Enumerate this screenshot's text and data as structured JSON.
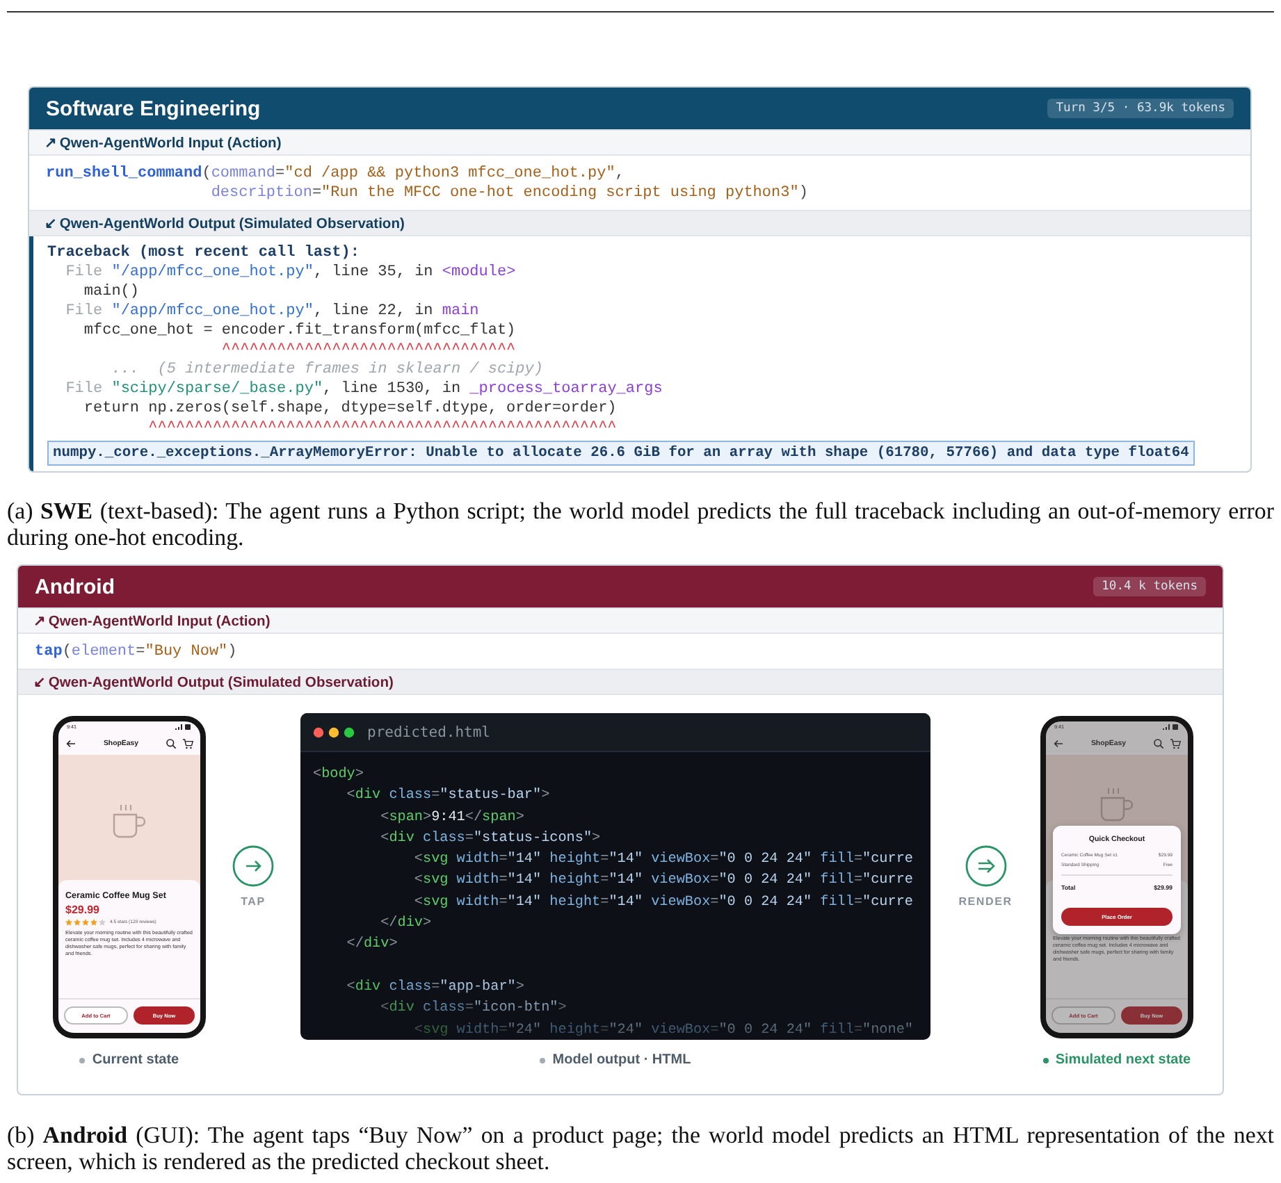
{
  "panels": [
    {
      "kind": "swe",
      "title": "Software Engineering",
      "badge": "Turn 3/5 · 63.9k tokens",
      "input_label": "↗ Qwen-AgentWorld Input (Action)",
      "input_code": [
        {
          "tokens": [
            {
              "kind": "fn",
              "text": "run_shell_command"
            },
            {
              "kind": "punct",
              "text": "("
            },
            {
              "kind": "param",
              "text": "command"
            },
            {
              "kind": "punct",
              "text": "="
            },
            {
              "kind": "str",
              "text": "\"cd /app && python3 mfcc_one_hot.py\""
            },
            {
              "kind": "punct",
              "text": ","
            }
          ]
        },
        {
          "tokens": [
            {
              "kind": "param",
              "text": "                  description"
            },
            {
              "kind": "punct",
              "text": "="
            },
            {
              "kind": "str",
              "text": "\"Run the MFCC one-hot encoding script using python3\""
            },
            {
              "kind": "punct",
              "text": ")"
            }
          ]
        }
      ],
      "output_label": "↙ Qwen-AgentWorld Output (Simulated Observation)",
      "output_code": [
        {
          "tokens": [
            {
              "kind": "head",
              "text": "Traceback (most recent call last):"
            }
          ]
        },
        {
          "tokens": [
            {
              "kind": "dim",
              "text": "  File "
            },
            {
              "kind": "path",
              "text": "\"/app/mfcc_one_hot.py\""
            },
            {
              "kind": "plain",
              "text": ", line 35, in "
            },
            {
              "kind": "kw",
              "text": "<module>"
            }
          ]
        },
        {
          "tokens": [
            {
              "kind": "plain",
              "text": "    main()"
            }
          ]
        },
        {
          "tokens": [
            {
              "kind": "dim",
              "text": "  File "
            },
            {
              "kind": "path",
              "text": "\"/app/mfcc_one_hot.py\""
            },
            {
              "kind": "plain",
              "text": ", line 22, in "
            },
            {
              "kind": "kw",
              "text": "main"
            }
          ]
        },
        {
          "tokens": [
            {
              "kind": "plain",
              "text": "    mfcc_one_hot = encoder.fit_transform(mfcc_flat)"
            }
          ]
        },
        {
          "tokens": [
            {
              "kind": "caret",
              "text": "                   ^^^^^^^^^^^^^^^^^^^^^^^^^^^^^^^^"
            }
          ]
        },
        {
          "tokens": [
            {
              "kind": "comment",
              "text": "       ...  (5 intermediate frames in sklearn / scipy)"
            }
          ]
        },
        {
          "tokens": [
            {
              "kind": "dim",
              "text": "  File "
            },
            {
              "kind": "libpath",
              "text": "\"scipy/sparse/_base.py\""
            },
            {
              "kind": "plain",
              "text": ", line 1530, in "
            },
            {
              "kind": "kw",
              "text": "_process_toarray_args"
            }
          ]
        },
        {
          "tokens": [
            {
              "kind": "plain",
              "text": "    return np.zeros(self.shape, dtype=self.dtype, order=order)"
            }
          ]
        },
        {
          "tokens": [
            {
              "kind": "caret",
              "text": "           ^^^^^^^^^^^^^^^^^^^^^^^^^^^^^^^^^^^^^^^^^^^^^^^^^^^"
            }
          ]
        }
      ],
      "error_line": "numpy._core._exceptions._ArrayMemoryError: Unable to allocate 26.6 GiB for an array with shape (61780, 57766) and data type float64",
      "caption": "(a) **SWE** (text-based): The agent runs a Python script; the world model predicts the full traceback including an out-of-memory error during one-hot encoding."
    },
    {
      "kind": "android",
      "title": "Android",
      "badge": "10.4 k tokens",
      "input_label": "↗ Qwen-AgentWorld Input (Action)",
      "input_code": [
        {
          "tokens": [
            {
              "kind": "fn",
              "text": "tap"
            },
            {
              "kind": "punct",
              "text": "("
            },
            {
              "kind": "param",
              "text": "element"
            },
            {
              "kind": "punct",
              "text": "="
            },
            {
              "kind": "str",
              "text": "\"Buy Now\""
            },
            {
              "kind": "punct",
              "text": ")"
            }
          ]
        }
      ],
      "output_label": "↙ Qwen-AgentWorld Output (Simulated Observation)",
      "stages": [
        {
          "kind": "phone",
          "status_time": "9:41",
          "app_title": "ShopEasy",
          "product_title": "Ceramic Coffee Mug Set",
          "price": "$29.99",
          "stars": 4,
          "rating_text": "4.5 stars (128 reviews)",
          "description": "Elevate your morning routine with this beautifully crafted ceramic coffee mug set. Includes 4 microwave and dishwasher safe mugs, perfect for sharing with family and friends.",
          "secondary_button": "Add to Cart",
          "primary_button": "Buy Now",
          "caption": {
            "text": "Current state",
            "color": "#a3abb5",
            "emphasis": false
          }
        },
        {
          "kind": "action",
          "label": "TAP"
        },
        {
          "kind": "code",
          "filename": "predicted.html",
          "lines": [
            {
              "tokens": [
                {
                  "kind": "punct",
                  "text": "<"
                },
                {
                  "kind": "tag",
                  "text": "body"
                },
                {
                  "kind": "punct",
                  "text": ">"
                }
              ]
            },
            {
              "tokens": [
                {
                  "kind": "punct",
                  "text": "    <"
                },
                {
                  "kind": "tag",
                  "text": "div"
                },
                {
                  "kind": "attr",
                  "text": " class"
                },
                {
                  "kind": "punct",
                  "text": "="
                },
                {
                  "kind": "str",
                  "text": "\"status-bar\""
                },
                {
                  "kind": "punct",
                  "text": ">"
                }
              ]
            },
            {
              "tokens": [
                {
                  "kind": "punct",
                  "text": "        <"
                },
                {
                  "kind": "tag",
                  "text": "span"
                },
                {
                  "kind": "punct",
                  "text": ">"
                },
                {
                  "kind": "text",
                  "text": "9:41"
                },
                {
                  "kind": "punct",
                  "text": "</"
                },
                {
                  "kind": "tag",
                  "text": "span"
                },
                {
                  "kind": "punct",
                  "text": ">"
                }
              ]
            },
            {
              "tokens": [
                {
                  "kind": "punct",
                  "text": "        <"
                },
                {
                  "kind": "tag",
                  "text": "div"
                },
                {
                  "kind": "attr",
                  "text": " class"
                },
                {
                  "kind": "punct",
                  "text": "="
                },
                {
                  "kind": "str",
                  "text": "\"status-icons\""
                },
                {
                  "kind": "punct",
                  "text": ">"
                }
              ]
            },
            {
              "tokens": [
                {
                  "kind": "punct",
                  "text": "            <"
                },
                {
                  "kind": "tag",
                  "text": "svg"
                },
                {
                  "kind": "attr",
                  "text": " width"
                },
                {
                  "kind": "punct",
                  "text": "="
                },
                {
                  "kind": "str",
                  "text": "\"14\""
                },
                {
                  "kind": "attr",
                  "text": " height"
                },
                {
                  "kind": "punct",
                  "text": "="
                },
                {
                  "kind": "str",
                  "text": "\"14\""
                },
                {
                  "kind": "attr",
                  "text": " viewBox"
                },
                {
                  "kind": "punct",
                  "text": "="
                },
                {
                  "kind": "str",
                  "text": "\"0 0 24 24\""
                },
                {
                  "kind": "attr",
                  "text": " fill"
                },
                {
                  "kind": "punct",
                  "text": "="
                },
                {
                  "kind": "str",
                  "text": "\"curre"
                }
              ]
            },
            {
              "tokens": [
                {
                  "kind": "punct",
                  "text": "            <"
                },
                {
                  "kind": "tag",
                  "text": "svg"
                },
                {
                  "kind": "attr",
                  "text": " width"
                },
                {
                  "kind": "punct",
                  "text": "="
                },
                {
                  "kind": "str",
                  "text": "\"14\""
                },
                {
                  "kind": "attr",
                  "text": " height"
                },
                {
                  "kind": "punct",
                  "text": "="
                },
                {
                  "kind": "str",
                  "text": "\"14\""
                },
                {
                  "kind": "attr",
                  "text": " viewBox"
                },
                {
                  "kind": "punct",
                  "text": "="
                },
                {
                  "kind": "str",
                  "text": "\"0 0 24 24\""
                },
                {
                  "kind": "attr",
                  "text": " fill"
                },
                {
                  "kind": "punct",
                  "text": "="
                },
                {
                  "kind": "str",
                  "text": "\"curre"
                }
              ]
            },
            {
              "tokens": [
                {
                  "kind": "punct",
                  "text": "            <"
                },
                {
                  "kind": "tag",
                  "text": "svg"
                },
                {
                  "kind": "attr",
                  "text": " width"
                },
                {
                  "kind": "punct",
                  "text": "="
                },
                {
                  "kind": "str",
                  "text": "\"14\""
                },
                {
                  "kind": "attr",
                  "text": " height"
                },
                {
                  "kind": "punct",
                  "text": "="
                },
                {
                  "kind": "str",
                  "text": "\"14\""
                },
                {
                  "kind": "attr",
                  "text": " viewBox"
                },
                {
                  "kind": "punct",
                  "text": "="
                },
                {
                  "kind": "str",
                  "text": "\"0 0 24 24\""
                },
                {
                  "kind": "attr",
                  "text": " fill"
                },
                {
                  "kind": "punct",
                  "text": "="
                },
                {
                  "kind": "str",
                  "text": "\"curre"
                }
              ]
            },
            {
              "tokens": [
                {
                  "kind": "punct",
                  "text": "        </"
                },
                {
                  "kind": "tag",
                  "text": "div"
                },
                {
                  "kind": "punct",
                  "text": ">"
                }
              ]
            },
            {
              "tokens": [
                {
                  "kind": "punct",
                  "text": "    </"
                },
                {
                  "kind": "tag",
                  "text": "div"
                },
                {
                  "kind": "punct",
                  "text": ">"
                }
              ]
            },
            {
              "gap_before": true,
              "tokens": [
                {
                  "kind": "punct",
                  "text": "    <"
                },
                {
                  "kind": "tag",
                  "text": "div"
                },
                {
                  "kind": "attr",
                  "text": " class"
                },
                {
                  "kind": "punct",
                  "text": "="
                },
                {
                  "kind": "str",
                  "text": "\"app-bar\""
                },
                {
                  "kind": "punct",
                  "text": ">"
                }
              ]
            },
            {
              "tokens": [
                {
                  "kind": "punct",
                  "text": "        <"
                },
                {
                  "kind": "tag",
                  "text": "div"
                },
                {
                  "kind": "attr",
                  "text": " class"
                },
                {
                  "kind": "punct",
                  "text": "="
                },
                {
                  "kind": "str",
                  "text": "\"icon-btn\""
                },
                {
                  "kind": "punct",
                  "text": ">"
                }
              ]
            },
            {
              "tokens": [
                {
                  "kind": "punct",
                  "text": "            <"
                },
                {
                  "kind": "tag",
                  "text": "svg"
                },
                {
                  "kind": "attr",
                  "text": " width"
                },
                {
                  "kind": "punct",
                  "text": "="
                },
                {
                  "kind": "str",
                  "text": "\"24\""
                },
                {
                  "kind": "attr",
                  "text": " height"
                },
                {
                  "kind": "punct",
                  "text": "="
                },
                {
                  "kind": "str",
                  "text": "\"24\""
                },
                {
                  "kind": "attr",
                  "text": " viewBox"
                },
                {
                  "kind": "punct",
                  "text": "="
                },
                {
                  "kind": "str",
                  "text": "\"0 0 24 24\""
                },
                {
                  "kind": "attr",
                  "text": " fill"
                },
                {
                  "kind": "punct",
                  "text": "="
                },
                {
                  "kind": "str",
                  "text": "\"none\""
                }
              ]
            }
          ],
          "caption": {
            "text": "Model output · HTML",
            "color": "#a3abb5",
            "emphasis": false
          }
        },
        {
          "kind": "render",
          "label": "RENDER"
        },
        {
          "kind": "phone",
          "status_time": "9:41",
          "app_title": "ShopEasy",
          "description": "Elevate your morning routine with this beautifully crafted ceramic coffee mug set. Includes 4 microwave and dishwasher safe mugs, perfect for sharing with family and friends.",
          "secondary_button": "Add to Cart",
          "primary_button": "Buy Now",
          "checkout": {
            "title": "Quick Checkout",
            "lines": [
              {
                "label": "Ceramic Coffee Mug Set x1",
                "amount": "$29.99"
              },
              {
                "label": "Standard Shipping",
                "amount": "Free"
              }
            ],
            "total_label": "Total",
            "total_amount": "$29.99",
            "button": "Place Order"
          },
          "caption": {
            "text": "Simulated next state",
            "color": "#2a9466",
            "emphasis": true
          }
        }
      ],
      "caption": "(b) **Android** (GUI): The agent taps “Buy Now” on a product page; the world model predicts an HTML representation of the next screen, which is rendered as the predicted checkout sheet."
    }
  ]
}
